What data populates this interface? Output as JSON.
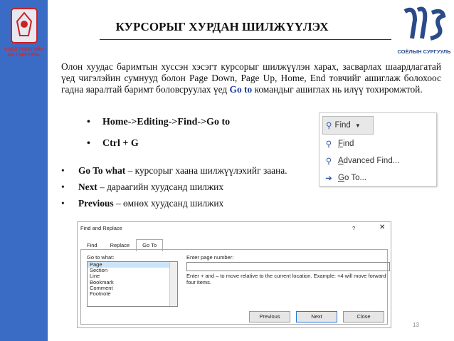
{
  "sidebar": {
    "university_name_line1": "СОЁЛ УРЛАГИЙН",
    "university_name_line2": "ИХ СУРГУУЛЬ"
  },
  "header": {
    "title": "КУРСОРЫГ ХУРДАН ШИЛЖҮҮЛЭХ",
    "school_name": "СОЁЛЫН СУРГУУЛЬ"
  },
  "body": {
    "paragraph_part1": "Олон хуудас баримтын хуссэн хэсэгт курсорыг шилжүүлэн харах, засварлах шаардлагатай үед чигэлэйин сумнууд болон Page Down, Page Up, Home, End товчийг ашиглаж болохоос гадна яаралтай баримт боловсруулах үед ",
    "paragraph_key": "Go to",
    "paragraph_part2": " командыг ашиглах нь илүү тохиромжтой.",
    "shortcuts": [
      "Home->Editing->Find->Go to",
      "Ctrl + G"
    ],
    "definitions": [
      {
        "term": "Go To what",
        "text": " – курсорыг хаана шилжүүлэхийг заана."
      },
      {
        "term": "Next",
        "text": " – дараагийн хуудсанд шилжих"
      },
      {
        "term": "Previous",
        "text": " – өмнөх хуудсанд шилжих"
      }
    ]
  },
  "find_menu": {
    "button_label": "Find",
    "items": [
      {
        "prefix": "",
        "accel": "F",
        "rest": "ind"
      },
      {
        "prefix": "",
        "accel": "A",
        "rest": "dvanced Find..."
      },
      {
        "prefix": "",
        "accel": "G",
        "rest": "o To..."
      }
    ]
  },
  "dialog": {
    "title": "Find and Replace",
    "help": "?",
    "close": "✕",
    "tabs": [
      "Find",
      "Replace",
      "Go To"
    ],
    "goto_label": "Go to what:",
    "goto_items": [
      "Page",
      "Section",
      "Line",
      "Bookmark",
      "Comment",
      "Footnote"
    ],
    "enter_label": "Enter page number:",
    "hint": "Enter + and – to move relative to the current location. Example: +4 will move forward four items.",
    "buttons": {
      "previous": "Previous",
      "next": "Next",
      "close": "Close"
    }
  },
  "page_number": "13"
}
